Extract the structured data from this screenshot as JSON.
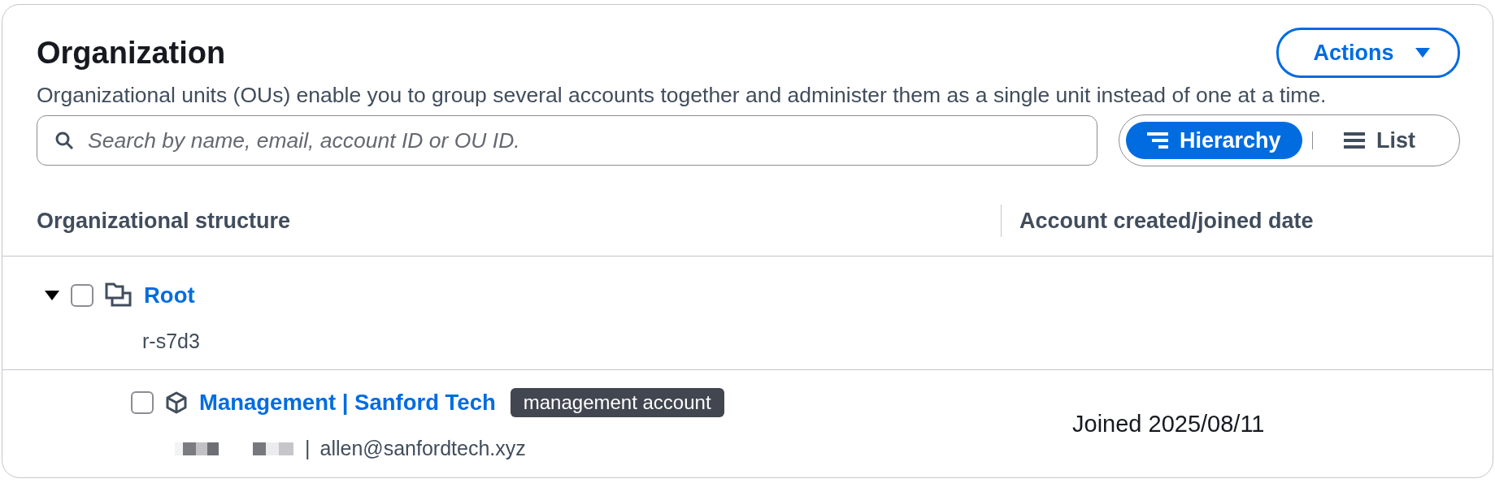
{
  "header": {
    "title": "Organization",
    "description": "Organizational units (OUs) enable you to group several accounts together and administer them as a single unit instead of one at a time.",
    "actions_button": "Actions"
  },
  "search": {
    "placeholder": "Search by name, email, account ID or OU ID."
  },
  "view_toggle": [
    {
      "label": "Hierarchy",
      "kind": "hierarchy",
      "selected": true
    },
    {
      "label": "List",
      "kind": "list",
      "selected": false
    }
  ],
  "table": {
    "columns": [
      "Organizational structure",
      "Account created/joined date"
    ],
    "rows": [
      {
        "kind": "root",
        "name": "Root",
        "id": "r-s7d3",
        "expanded": true,
        "checked": false,
        "children": [
          {
            "kind": "account",
            "name": "Management | Sanford Tech",
            "badge": "management account",
            "separator": "|",
            "email": "allen@sanfordtech.xyz",
            "date": "Joined 2025/08/11",
            "checked": false
          }
        ]
      }
    ]
  }
}
